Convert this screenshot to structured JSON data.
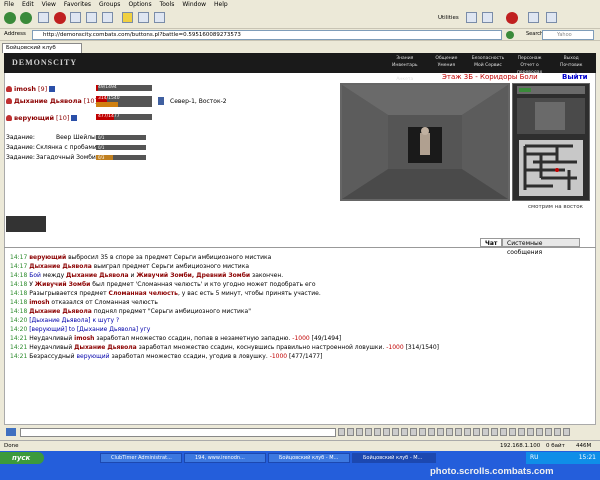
{
  "menu": [
    "File",
    "Edit",
    "View",
    "Favorites",
    "Groups",
    "Options",
    "Tools",
    "Window",
    "Help"
  ],
  "toolbar": {
    "utilities_label": "Utilities"
  },
  "address": {
    "label": "Address",
    "url": "http://demonscity.combats.com/buttons.pl?battle=0.595160089273573",
    "search_label": "Search",
    "search_placeholder": "Yahoo"
  },
  "tab": {
    "title": "Бойцовский клуб"
  },
  "banner": {
    "logo": "DEMONSCITY",
    "nav": [
      "Знания",
      "Общение",
      "Безопасность",
      "Персонаж",
      "Выход",
      "Инвентарь",
      "Умения",
      "Мой Сервис",
      "Отчет о переводах",
      "Почтовик",
      "Анкета"
    ]
  },
  "location": {
    "title": "Этаж 3Б - Коридоры Боли",
    "exit": "Выйти",
    "caption": "смотрим на восток",
    "coords": "Север-1, Восток-2"
  },
  "players": [
    {
      "name": "imosh",
      "level": "[9]",
      "hp_text": "49/1494",
      "hp": 0.033
    },
    {
      "name": "Дыхание Дьявола",
      "level": "[10]",
      "hp_text": "314/1540",
      "hp": 0.204,
      "mana": 0.4
    },
    {
      "name": "верующий",
      "level": "[10]",
      "hp_text": "477/1477",
      "hp": 0.323
    }
  ],
  "tasks": [
    {
      "label": "Задание:",
      "name": "Веер Шейлы",
      "progress": "0/1",
      "fill": 0.0
    },
    {
      "label": "Задание:",
      "name": "Склянка с пробами",
      "progress": "0/1",
      "fill": 0.0
    },
    {
      "label": "Задание:",
      "name": "Загадочный Зомби",
      "progress": "0/3",
      "fill": 0.33
    }
  ],
  "chat_tabs": [
    "Чат",
    "Системные сообщения"
  ],
  "chat": [
    {
      "ts": "14:17",
      "parts": [
        {
          "t": "верующий",
          "c": "pl"
        },
        {
          "t": " выбросил 35 в споре за предмет Серьги амбициозного мистика"
        }
      ]
    },
    {
      "ts": "14:17",
      "parts": [
        {
          "t": "Дыхание Дьявола",
          "c": "pl"
        },
        {
          "t": " выиграл предмет Серьги амбициозного мистика"
        }
      ]
    },
    {
      "ts": "14:18",
      "parts": [
        {
          "t": "Бой",
          "c": "pl2"
        },
        {
          "t": " между "
        },
        {
          "t": "Дыхание Дьявола",
          "c": "pl"
        },
        {
          "t": " и "
        },
        {
          "t": "Живучий Зомби, Древний Зомби",
          "c": "pl"
        },
        {
          "t": " закончен."
        }
      ]
    },
    {
      "ts": "14:18",
      "parts": [
        {
          "t": "У "
        },
        {
          "t": "Живучий Зомби",
          "c": "pl"
        },
        {
          "t": " был предмет 'Сломанная челюсть' и кто угодно может подобрать его"
        }
      ]
    },
    {
      "ts": "14:18",
      "parts": [
        {
          "t": "Разыгрывается предмет "
        },
        {
          "t": "Сломанная челюсть",
          "c": "pl"
        },
        {
          "t": ", у вас есть 5 минут, чтобы принять участие."
        }
      ]
    },
    {
      "ts": "14:18",
      "parts": [
        {
          "t": "imosh",
          "c": "pl"
        },
        {
          "t": " отказался от Сломанная челюсть"
        }
      ]
    },
    {
      "ts": "14:18",
      "parts": [
        {
          "t": "Дыхание Дьявола",
          "c": "pl"
        },
        {
          "t": " поднял предмет \"Серьги амбициозного мистика\""
        }
      ]
    },
    {
      "ts": "14:20",
      "parts": [
        {
          "t": "[Дыхание Дьявола]",
          "c": "pl2"
        },
        {
          "t": " к шуту ?",
          "c": "pl2"
        }
      ]
    },
    {
      "ts": "14:20",
      "parts": [
        {
          "t": "[верующий]",
          "c": "pl2"
        },
        {
          "t": " to [Дыхание Дьявола] угу",
          "c": "pl2"
        }
      ]
    },
    {
      "ts": "14:21",
      "parts": [
        {
          "t": "Неудачливый "
        },
        {
          "t": "imosh",
          "c": "pl"
        },
        {
          "t": " заработал множество ссадин, попав в незаметную западню. "
        },
        {
          "t": "-1000",
          "c": "dmg"
        },
        {
          "t": " [49/1494]"
        }
      ]
    },
    {
      "ts": "14:21",
      "parts": [
        {
          "t": "Неудачливый "
        },
        {
          "t": "Дыхание Дьявола",
          "c": "pl"
        },
        {
          "t": " заработал множество ссадин, коснувшись правильно настроенной ловушки. "
        },
        {
          "t": "-1000",
          "c": "dmg"
        },
        {
          "t": " [314/1540]"
        }
      ]
    },
    {
      "ts": "14:21",
      "parts": [
        {
          "t": "Безрассудный "
        },
        {
          "t": "верующий",
          "c": "pl2"
        },
        {
          "t": " заработал множество ссадин, угодив в ловушку. "
        },
        {
          "t": "-1000",
          "c": "dmg"
        },
        {
          "t": " [477/1477]"
        }
      ]
    }
  ],
  "status": {
    "left": "Done",
    "ip": "192.168.1.100",
    "speed": "0 байт",
    "mem": "446M"
  },
  "taskbar": {
    "start": "пуск",
    "buttons": [
      "ClubTimer Administrat...",
      "194, www.irenodn...",
      "Бойцовский клуб - M...",
      "Бойцовский клуб - M..."
    ],
    "lang": "RU",
    "time": "15:21"
  },
  "watermark": "photo.scrolls.combats.com"
}
